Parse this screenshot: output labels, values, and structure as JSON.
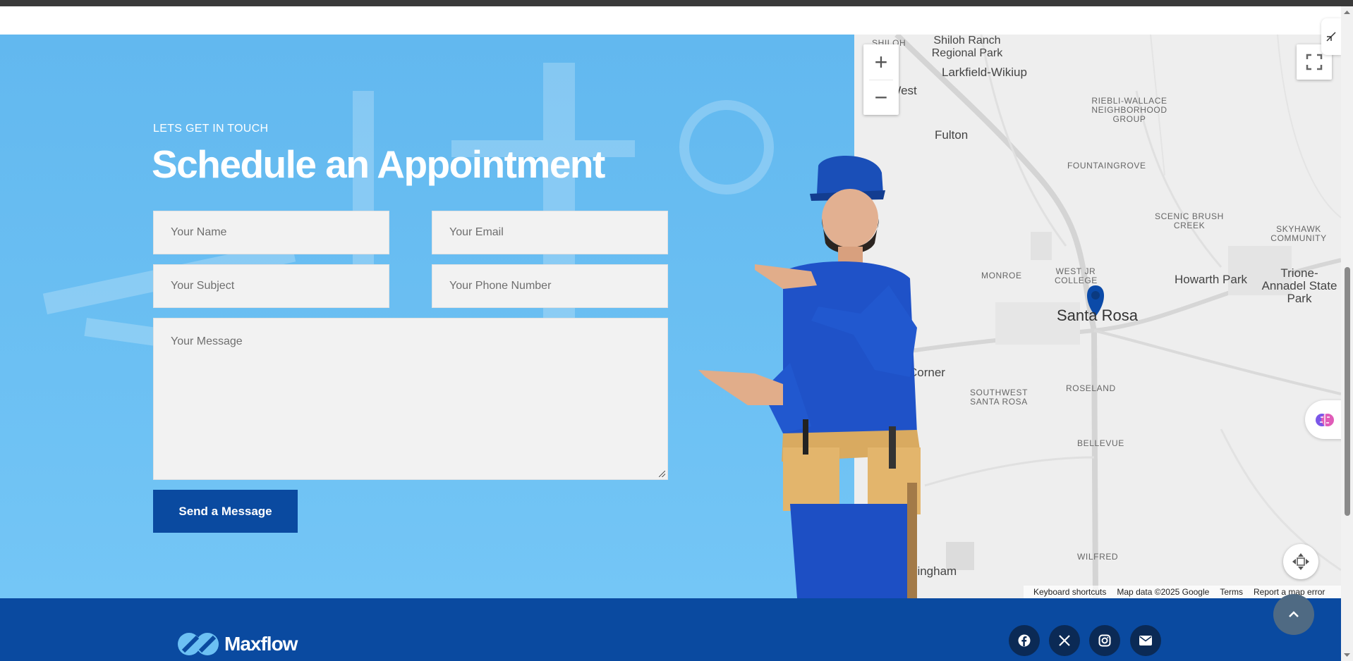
{
  "appointment": {
    "kicker": "LETS GET IN TOUCH",
    "title": "Schedule an Appointment",
    "fields": {
      "name_placeholder": "Your Name",
      "email_placeholder": "Your Email",
      "subject_placeholder": "Your Subject",
      "phone_placeholder": "Your Phone Number",
      "message_placeholder": "Your Message"
    },
    "submit_label": "Send a Message"
  },
  "map": {
    "places": {
      "shiloh": "SHILOH",
      "shiloh_park": "Shiloh Ranch Regional Park",
      "larkfield": "Larkfield-Wikiup",
      "mark_west": "ark West",
      "fulton": "Fulton",
      "rieblli": "RIEBLI-WALLACE NEIGHBORHOOD GROUP",
      "fountaingrove": "FOUNTAINGROVE",
      "scenic": "SCENIC BRUSH CREEK",
      "skyhawk": "SKYHAWK COMMUNITY",
      "monroe": "MONROE",
      "west_jr": "WEST JR COLLEGE",
      "howarth": "Howarth Park",
      "trione": "Trione-Annadel State Park",
      "santa_rosa": "Santa Rosa",
      "corner": "Corner",
      "southwest": "SOUTHWEST SANTA ROSA",
      "roseland": "ROSELAND",
      "bellevue": "BELLEVUE",
      "wilfred": "WILFRED",
      "ningham": "ningham"
    },
    "zoom_in_label": "+",
    "zoom_out_label": "−",
    "attribution": {
      "shortcuts": "Keyboard shortcuts",
      "data": "Map data ©2025 Google",
      "terms": "Terms",
      "report": "Report a map error"
    }
  },
  "footer": {
    "brand": "Maxflow",
    "social": [
      "facebook-icon",
      "x-twitter-icon",
      "instagram-icon",
      "email-icon"
    ]
  },
  "colors": {
    "section_blue": "#6cc0f3",
    "button_blue": "#0a4aa0",
    "footer_blue": "#0a4aa0",
    "pin_blue": "#0b4aa8",
    "field_bg": "#f2f2f2"
  }
}
